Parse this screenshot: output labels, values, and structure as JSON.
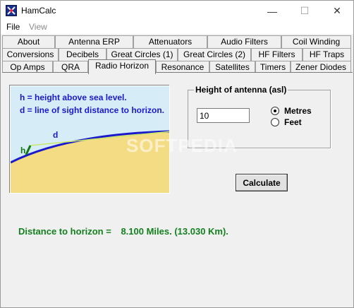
{
  "window": {
    "title": "HamCalc",
    "controls": {
      "minimize": "—",
      "maximize": "☐",
      "close": "✕"
    }
  },
  "menu": {
    "file": "File",
    "view": "View"
  },
  "tabs": {
    "row1": [
      "About",
      "Antenna ERP",
      "Attenuators",
      "Audio Filters",
      "Coil Winding"
    ],
    "row2": [
      "Conversions",
      "Decibels",
      "Great Circles (1)",
      "Great Circles (2)",
      "HF Filters",
      "HF Traps"
    ],
    "row3": [
      "Op Amps",
      "QRA",
      "Radio Horizon",
      "Resonance",
      "Satellites",
      "Timers",
      "Zener Diodes"
    ],
    "selected": "Radio Horizon"
  },
  "diagram": {
    "line_h": "h = height above sea level.",
    "line_d": "d = line of sight distance to horizon.",
    "label_h": "h",
    "label_d": "d"
  },
  "height_group": {
    "label": "Height of antenna (asl)",
    "value": "10",
    "options": [
      {
        "label": "Metres",
        "checked": true
      },
      {
        "label": "Feet",
        "checked": false
      }
    ]
  },
  "calculate_label": "Calculate",
  "result": {
    "label": "Distance to horizon =",
    "value": "8.100 Miles. (13.030 Km)."
  },
  "watermark": "SOFTPEDIA",
  "colors": {
    "result_text": "#13801e",
    "diagram_text": "#1a1acc",
    "sky": "#d6ecf7",
    "land": "#f4dc84",
    "horizon": "#1a1acc"
  }
}
